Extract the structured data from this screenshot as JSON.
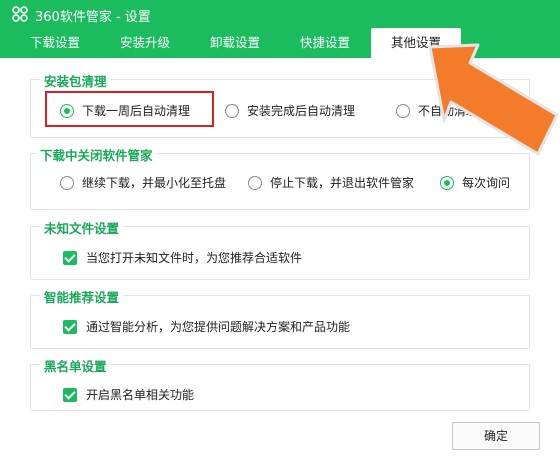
{
  "window": {
    "title": "360软件管家 - 设置",
    "icon": "app-grid-icon"
  },
  "tabs": [
    {
      "label": "下载设置"
    },
    {
      "label": "安装升级"
    },
    {
      "label": "卸载设置"
    },
    {
      "label": "快捷设置"
    },
    {
      "label": "其他设置",
      "active": true
    }
  ],
  "sections": {
    "package_cleanup": {
      "title": "安装包清理",
      "options": [
        "下载一周后自动清理",
        "安装完成后自动清理",
        "不自动清理"
      ],
      "selected": "下载一周后自动清理"
    },
    "close_while_downloading": {
      "title": "下载中关闭软件管家",
      "options": [
        "继续下载，并最小化至托盘",
        "停止下载，并退出软件管家",
        "每次询问"
      ],
      "selected": "每次询问"
    },
    "unknown_file": {
      "title": "未知文件设置",
      "checkbox_label": "当您打开未知文件时，为您推荐合适软件",
      "checked": true
    },
    "smart_recommend": {
      "title": "智能推荐设置",
      "checkbox_label": "通过智能分析，为您提供问题解决方案和产品功能",
      "checked": true
    },
    "blacklist": {
      "title": "黑名单设置",
      "checkbox_label": "开启黑名单相关功能",
      "checked": true
    }
  },
  "footer": {
    "ok_label": "确定"
  },
  "colors": {
    "accent": "#1bbc5e",
    "section_title": "#1aa85a",
    "highlight_box": "#d9201c",
    "arrow": "#f47b2a"
  }
}
